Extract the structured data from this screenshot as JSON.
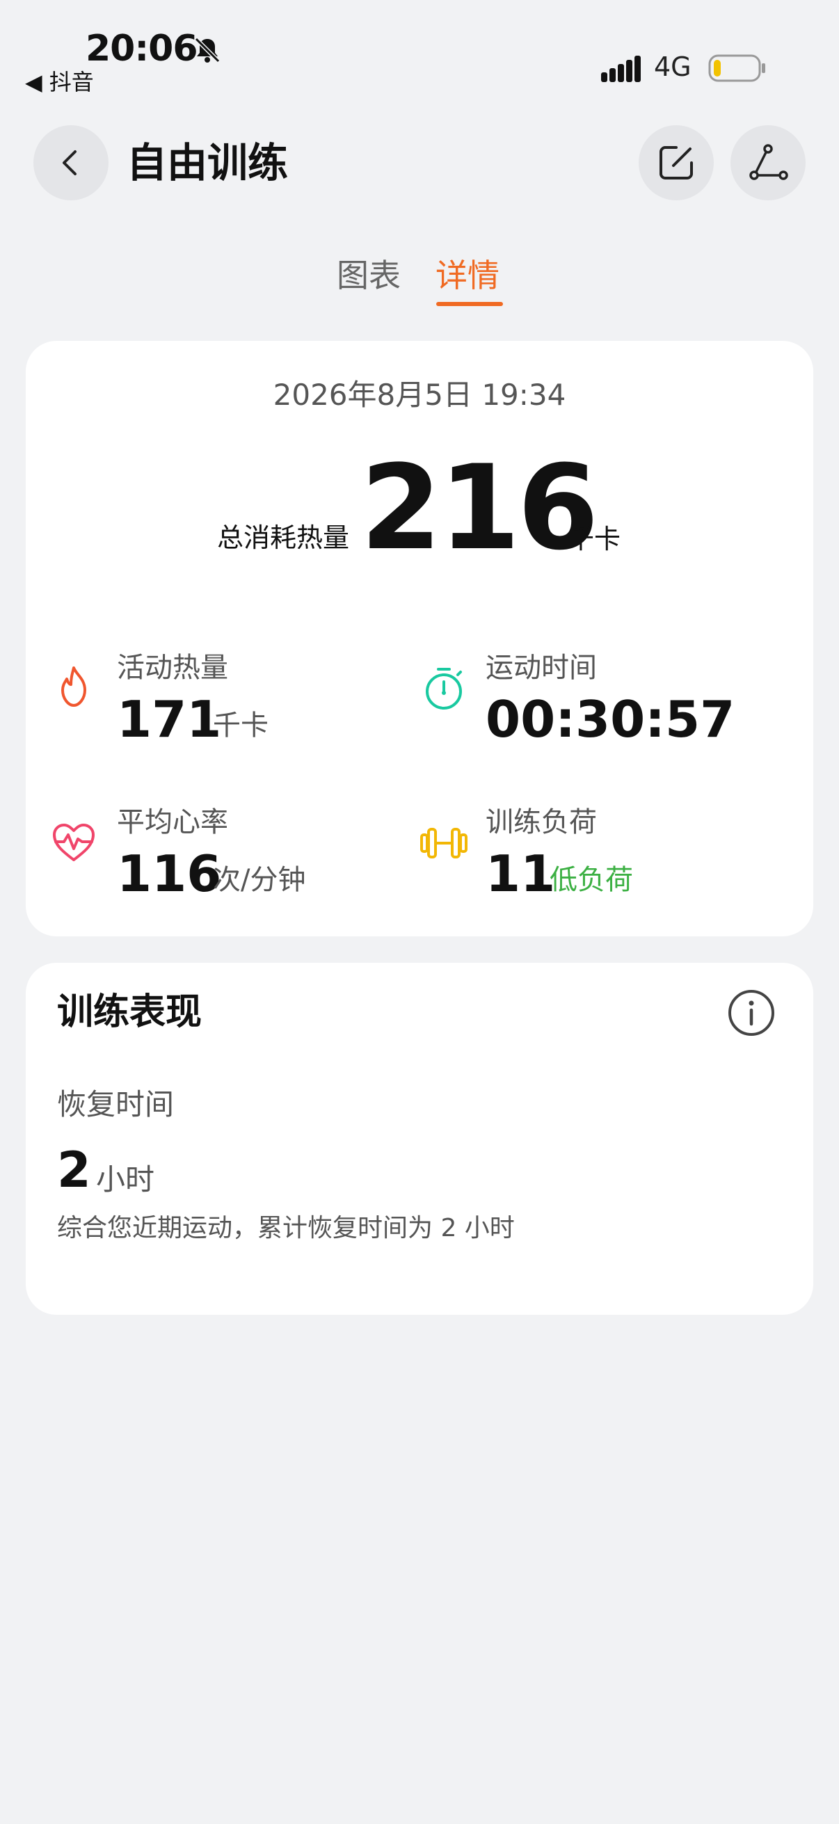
{
  "status_bar": {
    "time": "20:06",
    "back_app": "◀ 抖音",
    "network": "4G",
    "battery_color": "#f2c200"
  },
  "header": {
    "title": "自由训练",
    "icons": {
      "back": "chevron-left-icon",
      "edit": "edit-icon",
      "share": "share-icon"
    }
  },
  "tabs": [
    {
      "label": "图表",
      "active": false
    },
    {
      "label": "详情",
      "active": true
    }
  ],
  "summary": {
    "datetime": "2026年8月5日 19:34",
    "total_label": "总消耗热量",
    "total_value": "216",
    "total_unit": "千卡",
    "metrics": [
      {
        "label": "活动热量",
        "value": "171",
        "unit": "千卡",
        "icon": "flame-icon",
        "color": "#f0562e"
      },
      {
        "label": "运动时间",
        "value": "00:30:57",
        "unit": "",
        "icon": "stopwatch-icon",
        "color": "#19c9a0"
      },
      {
        "label": "平均心率",
        "value": "116",
        "unit": "次/分钟",
        "icon": "heart-rate-icon",
        "color": "#f0456a"
      },
      {
        "label": "训练负荷",
        "value": "11",
        "unit": "低负荷",
        "icon": "dumbbell-icon",
        "color": "#f2b705",
        "unit_color": "#3cb043"
      }
    ]
  },
  "performance": {
    "title": "训练表现",
    "recovery_label": "恢复时间",
    "recovery_value": "2",
    "recovery_unit": "小时",
    "description": "综合您近期运动，累计恢复时间为 2 小时"
  },
  "colors": {
    "accent": "#f06a22",
    "background": "#f1f2f4",
    "card": "#ffffff"
  }
}
